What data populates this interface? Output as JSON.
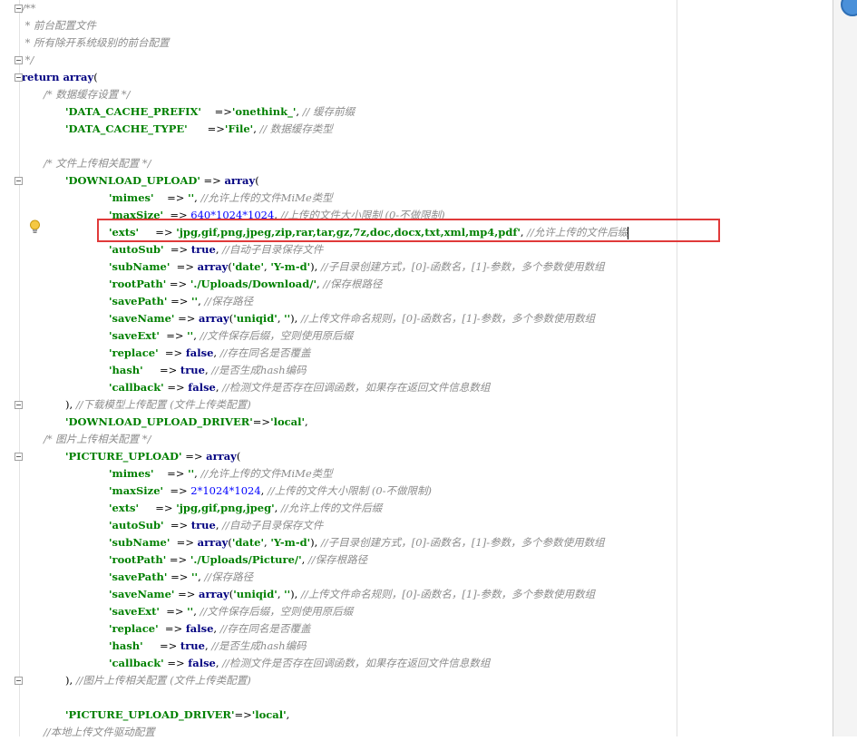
{
  "lines": [
    {
      "indent": 0,
      "tokens": [
        {
          "t": "/**",
          "c": "c"
        }
      ]
    },
    {
      "indent": 0,
      "tokens": [
        {
          "t": " * 前台配置文件",
          "c": "c"
        }
      ]
    },
    {
      "indent": 0,
      "tokens": [
        {
          "t": " * 所有除开系统级别的前台配置",
          "c": "c"
        }
      ]
    },
    {
      "indent": 0,
      "tokens": [
        {
          "t": " */",
          "c": "c"
        }
      ]
    },
    {
      "indent": 0,
      "tokens": [
        {
          "t": "return array",
          "c": "k"
        },
        {
          "t": "(",
          "c": "o"
        }
      ]
    },
    {
      "indent": 1,
      "tokens": [
        {
          "t": "/* 数据缓存设置 */",
          "c": "c"
        }
      ]
    },
    {
      "indent": 2,
      "tokens": [
        {
          "t": "'DATA_CACHE_PREFIX'",
          "c": "s"
        },
        {
          "t": "    =>",
          "c": "o"
        },
        {
          "t": "'onethink_'",
          "c": "s"
        },
        {
          "t": ", ",
          "c": "o"
        },
        {
          "t": "// 缓存前缀",
          "c": "c"
        }
      ]
    },
    {
      "indent": 2,
      "tokens": [
        {
          "t": "'DATA_CACHE_TYPE'",
          "c": "s"
        },
        {
          "t": "      =>",
          "c": "o"
        },
        {
          "t": "'File'",
          "c": "s"
        },
        {
          "t": ", ",
          "c": "o"
        },
        {
          "t": "// 数据缓存类型",
          "c": "c"
        }
      ]
    },
    {
      "indent": 0,
      "tokens": []
    },
    {
      "indent": 1,
      "tokens": [
        {
          "t": "/* 文件上传相关配置 */",
          "c": "c"
        }
      ]
    },
    {
      "indent": 2,
      "tokens": [
        {
          "t": "'DOWNLOAD_UPLOAD'",
          "c": "s"
        },
        {
          "t": " => ",
          "c": "o"
        },
        {
          "t": "array",
          "c": "k"
        },
        {
          "t": "(",
          "c": "o"
        }
      ]
    },
    {
      "indent": 4,
      "tokens": [
        {
          "t": "'mimes'",
          "c": "s"
        },
        {
          "t": "    => ",
          "c": "o"
        },
        {
          "t": "''",
          "c": "s"
        },
        {
          "t": ", ",
          "c": "o"
        },
        {
          "t": "//允许上传的文件MiMe类型",
          "c": "c"
        }
      ]
    },
    {
      "indent": 4,
      "tokens": [
        {
          "t": "'maxSize'",
          "c": "s"
        },
        {
          "t": "  => ",
          "c": "o"
        },
        {
          "t": "640*1024*1024",
          "c": "n"
        },
        {
          "t": ", ",
          "c": "o"
        },
        {
          "t": "//上传的文件大小限制 (0-不做限制)",
          "c": "c"
        }
      ]
    },
    {
      "indent": 4,
      "tokens": [
        {
          "t": "'exts'",
          "c": "s"
        },
        {
          "t": "     => ",
          "c": "o"
        },
        {
          "t": "'jpg,gif,png,jpeg,zip,rar,tar,gz,7z,doc,docx,txt,xml,mp4,pdf'",
          "c": "s"
        },
        {
          "t": ", ",
          "c": "o"
        },
        {
          "t": "//允许上传的文件后缀",
          "c": "c"
        }
      ]
    },
    {
      "indent": 4,
      "tokens": [
        {
          "t": "'autoSub'",
          "c": "s"
        },
        {
          "t": "  => ",
          "c": "o"
        },
        {
          "t": "true",
          "c": "k"
        },
        {
          "t": ", ",
          "c": "o"
        },
        {
          "t": "//自动子目录保存文件",
          "c": "c"
        }
      ]
    },
    {
      "indent": 4,
      "tokens": [
        {
          "t": "'subName'",
          "c": "s"
        },
        {
          "t": "  => ",
          "c": "o"
        },
        {
          "t": "array",
          "c": "k"
        },
        {
          "t": "(",
          "c": "o"
        },
        {
          "t": "'date'",
          "c": "s"
        },
        {
          "t": ", ",
          "c": "o"
        },
        {
          "t": "'Y-m-d'",
          "c": "s"
        },
        {
          "t": "), ",
          "c": "o"
        },
        {
          "t": "//子目录创建方式，[0]-函数名，[1]-参数，多个参数使用数组",
          "c": "c"
        }
      ]
    },
    {
      "indent": 4,
      "tokens": [
        {
          "t": "'rootPath'",
          "c": "s"
        },
        {
          "t": " => ",
          "c": "o"
        },
        {
          "t": "'./Uploads/Download/'",
          "c": "s"
        },
        {
          "t": ", ",
          "c": "o"
        },
        {
          "t": "//保存根路径",
          "c": "c"
        }
      ]
    },
    {
      "indent": 4,
      "tokens": [
        {
          "t": "'savePath'",
          "c": "s"
        },
        {
          "t": " => ",
          "c": "o"
        },
        {
          "t": "''",
          "c": "s"
        },
        {
          "t": ", ",
          "c": "o"
        },
        {
          "t": "//保存路径",
          "c": "c"
        }
      ]
    },
    {
      "indent": 4,
      "tokens": [
        {
          "t": "'saveName'",
          "c": "s"
        },
        {
          "t": " => ",
          "c": "o"
        },
        {
          "t": "array",
          "c": "k"
        },
        {
          "t": "(",
          "c": "o"
        },
        {
          "t": "'uniqid'",
          "c": "s"
        },
        {
          "t": ", ",
          "c": "o"
        },
        {
          "t": "''",
          "c": "s"
        },
        {
          "t": "), ",
          "c": "o"
        },
        {
          "t": "//上传文件命名规则，[0]-函数名，[1]-参数，多个参数使用数组",
          "c": "c"
        }
      ]
    },
    {
      "indent": 4,
      "tokens": [
        {
          "t": "'saveExt'",
          "c": "s"
        },
        {
          "t": "  => ",
          "c": "o"
        },
        {
          "t": "''",
          "c": "s"
        },
        {
          "t": ", ",
          "c": "o"
        },
        {
          "t": "//文件保存后缀，空则使用原后缀",
          "c": "c"
        }
      ]
    },
    {
      "indent": 4,
      "tokens": [
        {
          "t": "'replace'",
          "c": "s"
        },
        {
          "t": "  => ",
          "c": "o"
        },
        {
          "t": "false",
          "c": "k"
        },
        {
          "t": ", ",
          "c": "o"
        },
        {
          "t": "//存在同名是否覆盖",
          "c": "c"
        }
      ]
    },
    {
      "indent": 4,
      "tokens": [
        {
          "t": "'hash'",
          "c": "s"
        },
        {
          "t": "     => ",
          "c": "o"
        },
        {
          "t": "true",
          "c": "k"
        },
        {
          "t": ", ",
          "c": "o"
        },
        {
          "t": "//是否生成hash编码",
          "c": "c"
        }
      ]
    },
    {
      "indent": 4,
      "tokens": [
        {
          "t": "'callback'",
          "c": "s"
        },
        {
          "t": " => ",
          "c": "o"
        },
        {
          "t": "false",
          "c": "k"
        },
        {
          "t": ", ",
          "c": "o"
        },
        {
          "t": "//检测文件是否存在回调函数，如果存在返回文件信息数组",
          "c": "c"
        }
      ]
    },
    {
      "indent": 2,
      "tokens": [
        {
          "t": "), ",
          "c": "o"
        },
        {
          "t": "//下载模型上传配置 (文件上传类配置)",
          "c": "c"
        }
      ]
    },
    {
      "indent": 2,
      "tokens": [
        {
          "t": "'DOWNLOAD_UPLOAD_DRIVER'",
          "c": "s"
        },
        {
          "t": "=>",
          "c": "o"
        },
        {
          "t": "'local'",
          "c": "s"
        },
        {
          "t": ",",
          "c": "o"
        }
      ]
    },
    {
      "indent": 1,
      "tokens": [
        {
          "t": "/* 图片上传相关配置 */",
          "c": "c"
        }
      ]
    },
    {
      "indent": 2,
      "tokens": [
        {
          "t": "'PICTURE_UPLOAD'",
          "c": "s"
        },
        {
          "t": " => ",
          "c": "o"
        },
        {
          "t": "array",
          "c": "k"
        },
        {
          "t": "(",
          "c": "o"
        }
      ]
    },
    {
      "indent": 4,
      "tokens": [
        {
          "t": "'mimes'",
          "c": "s"
        },
        {
          "t": "    => ",
          "c": "o"
        },
        {
          "t": "''",
          "c": "s"
        },
        {
          "t": ", ",
          "c": "o"
        },
        {
          "t": "//允许上传的文件MiMe类型",
          "c": "c"
        }
      ]
    },
    {
      "indent": 4,
      "tokens": [
        {
          "t": "'maxSize'",
          "c": "s"
        },
        {
          "t": "  => ",
          "c": "o"
        },
        {
          "t": "2*1024*1024",
          "c": "n"
        },
        {
          "t": ", ",
          "c": "o"
        },
        {
          "t": "//上传的文件大小限制 (0-不做限制)",
          "c": "c"
        }
      ]
    },
    {
      "indent": 4,
      "tokens": [
        {
          "t": "'exts'",
          "c": "s"
        },
        {
          "t": "     => ",
          "c": "o"
        },
        {
          "t": "'jpg,gif,png,jpeg'",
          "c": "s"
        },
        {
          "t": ", ",
          "c": "o"
        },
        {
          "t": "//允许上传的文件后缀",
          "c": "c"
        }
      ]
    },
    {
      "indent": 4,
      "tokens": [
        {
          "t": "'autoSub'",
          "c": "s"
        },
        {
          "t": "  => ",
          "c": "o"
        },
        {
          "t": "true",
          "c": "k"
        },
        {
          "t": ", ",
          "c": "o"
        },
        {
          "t": "//自动子目录保存文件",
          "c": "c"
        }
      ]
    },
    {
      "indent": 4,
      "tokens": [
        {
          "t": "'subName'",
          "c": "s"
        },
        {
          "t": "  => ",
          "c": "o"
        },
        {
          "t": "array",
          "c": "k"
        },
        {
          "t": "(",
          "c": "o"
        },
        {
          "t": "'date'",
          "c": "s"
        },
        {
          "t": ", ",
          "c": "o"
        },
        {
          "t": "'Y-m-d'",
          "c": "s"
        },
        {
          "t": "), ",
          "c": "o"
        },
        {
          "t": "//子目录创建方式，[0]-函数名，[1]-参数，多个参数使用数组",
          "c": "c"
        }
      ]
    },
    {
      "indent": 4,
      "tokens": [
        {
          "t": "'rootPath'",
          "c": "s"
        },
        {
          "t": " => ",
          "c": "o"
        },
        {
          "t": "'./Uploads/Picture/'",
          "c": "s"
        },
        {
          "t": ", ",
          "c": "o"
        },
        {
          "t": "//保存根路径",
          "c": "c"
        }
      ]
    },
    {
      "indent": 4,
      "tokens": [
        {
          "t": "'savePath'",
          "c": "s"
        },
        {
          "t": " => ",
          "c": "o"
        },
        {
          "t": "''",
          "c": "s"
        },
        {
          "t": ", ",
          "c": "o"
        },
        {
          "t": "//保存路径",
          "c": "c"
        }
      ]
    },
    {
      "indent": 4,
      "tokens": [
        {
          "t": "'saveName'",
          "c": "s"
        },
        {
          "t": " => ",
          "c": "o"
        },
        {
          "t": "array",
          "c": "k"
        },
        {
          "t": "(",
          "c": "o"
        },
        {
          "t": "'uniqid'",
          "c": "s"
        },
        {
          "t": ", ",
          "c": "o"
        },
        {
          "t": "''",
          "c": "s"
        },
        {
          "t": "), ",
          "c": "o"
        },
        {
          "t": "//上传文件命名规则，[0]-函数名，[1]-参数，多个参数使用数组",
          "c": "c"
        }
      ]
    },
    {
      "indent": 4,
      "tokens": [
        {
          "t": "'saveExt'",
          "c": "s"
        },
        {
          "t": "  => ",
          "c": "o"
        },
        {
          "t": "''",
          "c": "s"
        },
        {
          "t": ", ",
          "c": "o"
        },
        {
          "t": "//文件保存后缀，空则使用原后缀",
          "c": "c"
        }
      ]
    },
    {
      "indent": 4,
      "tokens": [
        {
          "t": "'replace'",
          "c": "s"
        },
        {
          "t": "  => ",
          "c": "o"
        },
        {
          "t": "false",
          "c": "k"
        },
        {
          "t": ", ",
          "c": "o"
        },
        {
          "t": "//存在同名是否覆盖",
          "c": "c"
        }
      ]
    },
    {
      "indent": 4,
      "tokens": [
        {
          "t": "'hash'",
          "c": "s"
        },
        {
          "t": "     => ",
          "c": "o"
        },
        {
          "t": "true",
          "c": "k"
        },
        {
          "t": ", ",
          "c": "o"
        },
        {
          "t": "//是否生成hash编码",
          "c": "c"
        }
      ]
    },
    {
      "indent": 4,
      "tokens": [
        {
          "t": "'callback'",
          "c": "s"
        },
        {
          "t": " => ",
          "c": "o"
        },
        {
          "t": "false",
          "c": "k"
        },
        {
          "t": ", ",
          "c": "o"
        },
        {
          "t": "//检测文件是否存在回调函数，如果存在返回文件信息数组",
          "c": "c"
        }
      ]
    },
    {
      "indent": 2,
      "tokens": [
        {
          "t": "), ",
          "c": "o"
        },
        {
          "t": "//图片上传相关配置 (文件上传类配置)",
          "c": "c"
        }
      ]
    },
    {
      "indent": 0,
      "tokens": []
    },
    {
      "indent": 2,
      "tokens": [
        {
          "t": "'PICTURE_UPLOAD_DRIVER'",
          "c": "s"
        },
        {
          "t": "=>",
          "c": "o"
        },
        {
          "t": "'local'",
          "c": "s"
        },
        {
          "t": ",",
          "c": "o"
        }
      ]
    },
    {
      "indent": 1,
      "tokens": [
        {
          "t": "//本地上传文件驱动配置",
          "c": "c"
        }
      ]
    }
  ],
  "highlight": {
    "line_index": 13,
    "color": "#e03a3a"
  },
  "colors": {
    "comment": "#8c8c8c",
    "keyword": "#000080",
    "string": "#008000",
    "number": "#0000ff"
  },
  "icons": {
    "bulb": "lightbulb-icon",
    "info": "info-icon"
  }
}
